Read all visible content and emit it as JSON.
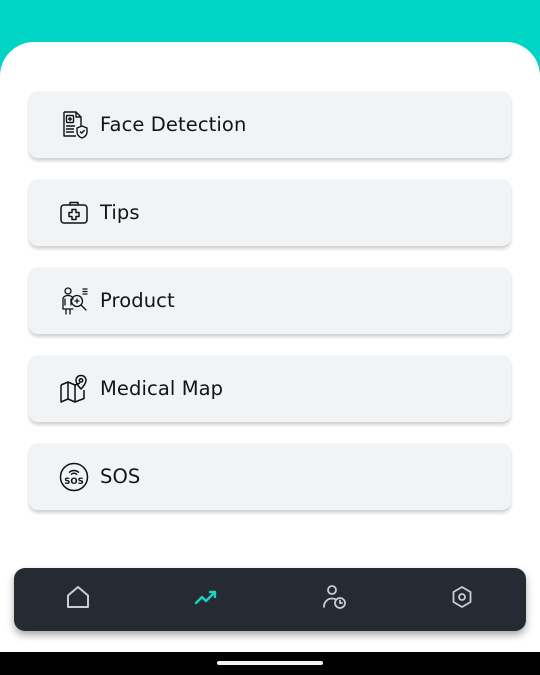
{
  "colors": {
    "accent": "#00d4c5",
    "card_bg": "#f1f4f7",
    "navbar_bg": "#262b33",
    "nav_icon_inactive": "#c9ced6",
    "nav_icon_active": "#19d3c2"
  },
  "menu": {
    "items": [
      {
        "label": "Face Detection",
        "icon": "medical-report-shield-icon"
      },
      {
        "label": "Tips",
        "icon": "first-aid-kit-icon"
      },
      {
        "label": "Product",
        "icon": "person-magnifier-icon"
      },
      {
        "label": "Medical Map",
        "icon": "map-pin-icon"
      },
      {
        "label": "SOS",
        "icon": "sos-signal-icon"
      }
    ]
  },
  "bottom_nav": {
    "items": [
      {
        "icon": "home-icon",
        "active": false
      },
      {
        "icon": "trend-chart-icon",
        "active": true
      },
      {
        "icon": "user-clock-icon",
        "active": false
      },
      {
        "icon": "hexagon-settings-icon",
        "active": false
      }
    ]
  }
}
